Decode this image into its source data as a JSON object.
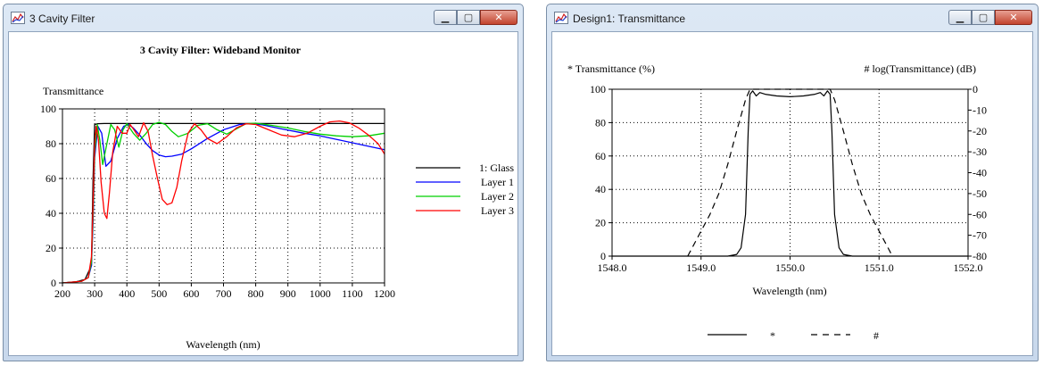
{
  "windows": [
    {
      "title": "3 Cavity Filter",
      "controls": {
        "minimize": "▁",
        "maximize": "▢",
        "close": "✕"
      }
    },
    {
      "title": "Design1: Transmittance",
      "controls": {
        "minimize": "▁",
        "maximize": "▢",
        "close": "✕"
      }
    }
  ],
  "chart_data": [
    {
      "type": "line",
      "title": "3 Cavity Filter: Wideband Monitor",
      "ylabel": "Transmittance",
      "xlabel": "Wavelength (nm)",
      "xlim": [
        200,
        1200
      ],
      "ylim": [
        0,
        100
      ],
      "xticks": [
        200,
        300,
        400,
        500,
        600,
        700,
        800,
        900,
        1000,
        1100,
        1200
      ],
      "yticks": [
        0,
        20,
        40,
        60,
        80,
        100
      ],
      "grid": true,
      "legend_position": "right",
      "series": [
        {
          "name": "1: Glass",
          "color": "#000000",
          "x": [
            200,
            240,
            270,
            290,
            295,
            300,
            310,
            330,
            400,
            600,
            800,
            1000,
            1200
          ],
          "y": [
            0,
            0.5,
            2,
            10,
            60,
            91,
            91.5,
            91.6,
            91.6,
            91.6,
            91.6,
            91.6,
            91.6
          ]
        },
        {
          "name": "Layer 1",
          "color": "#0000ff",
          "x": [
            200,
            260,
            280,
            290,
            295,
            300,
            310,
            322,
            335,
            350,
            370,
            390,
            405,
            420,
            440,
            460,
            480,
            500,
            520,
            540,
            570,
            600,
            650,
            700,
            750,
            780,
            820,
            880,
            950,
            1000,
            1050,
            1100,
            1150,
            1200
          ],
          "y": [
            0,
            1,
            3,
            10,
            35,
            72,
            90,
            86,
            67,
            70,
            83,
            90,
            91,
            89,
            85,
            80,
            76,
            73.5,
            72.5,
            72.8,
            74,
            77,
            83,
            88,
            91,
            91.5,
            90.8,
            88.5,
            86,
            84.5,
            82.5,
            80.5,
            78.5,
            76.5
          ]
        },
        {
          "name": "Layer 2",
          "color": "#00d000",
          "x": [
            200,
            260,
            280,
            290,
            295,
            300,
            308,
            316,
            325,
            338,
            350,
            362,
            375,
            388,
            400,
            420,
            440,
            460,
            480,
            500,
            520,
            540,
            560,
            590,
            620,
            650,
            680,
            710,
            740,
            770,
            800,
            850,
            900,
            950,
            1000,
            1050,
            1100,
            1150,
            1200
          ],
          "y": [
            0,
            1,
            3,
            12,
            40,
            75,
            91,
            82,
            68,
            80,
            91,
            88,
            78,
            88,
            91.5,
            86,
            82,
            86,
            91,
            92.3,
            91,
            87,
            84,
            86,
            90.5,
            91.5,
            88,
            85.5,
            88.5,
            91.5,
            91.8,
            90.5,
            89,
            87,
            85.5,
            84.5,
            84,
            84.5,
            86
          ]
        },
        {
          "name": "Layer 3",
          "color": "#ff0000",
          "x": [
            200,
            260,
            280,
            290,
            295,
            300,
            305,
            312,
            320,
            330,
            338,
            346,
            356,
            370,
            385,
            400,
            410,
            422,
            436,
            452,
            466,
            480,
            495,
            510,
            525,
            540,
            555,
            570,
            590,
            610,
            630,
            650,
            680,
            710,
            740,
            770,
            800,
            840,
            880,
            920,
            960,
            1000,
            1030,
            1060,
            1090,
            1120,
            1150,
            1180,
            1200
          ],
          "y": [
            0,
            1,
            3,
            15,
            45,
            80,
            90,
            82,
            58,
            40,
            37,
            52,
            75,
            90,
            86,
            86,
            91,
            88,
            84,
            92,
            87,
            73,
            60,
            48,
            45,
            46,
            55,
            70,
            86,
            91.5,
            88,
            83,
            80,
            84,
            89,
            91.5,
            91,
            88,
            85,
            84,
            86,
            90,
            92.5,
            93,
            92,
            89,
            85,
            80,
            74
          ]
        }
      ]
    },
    {
      "type": "line",
      "title": "",
      "ylabel_left": "* Transmittance (%)",
      "ylabel_right": "# log(Transmittance) (dB)",
      "xlabel": "Wavelength (nm)",
      "xlim": [
        1548.0,
        1552.0
      ],
      "xticks": [
        "1548.0",
        "1549.0",
        "1550.0",
        "1551.0",
        "1552.0"
      ],
      "ylim_left": [
        0,
        100
      ],
      "yticks_left": [
        0,
        20,
        40,
        60,
        80,
        100
      ],
      "ylim_right": [
        -80,
        0
      ],
      "yticks_right": [
        0,
        -10,
        -20,
        -30,
        -40,
        -50,
        -60,
        -70,
        -80
      ],
      "grid": true,
      "legend_position": "bottom",
      "series": [
        {
          "name": "*",
          "color": "#000000",
          "style": "solid",
          "axis": "left",
          "x": [
            1548.0,
            1549.3,
            1549.4,
            1549.45,
            1549.5,
            1549.53,
            1549.55,
            1549.58,
            1549.62,
            1549.66,
            1549.72,
            1549.85,
            1550.0,
            1550.15,
            1550.28,
            1550.34,
            1550.38,
            1550.42,
            1550.45,
            1550.47,
            1550.5,
            1550.55,
            1550.6,
            1550.7,
            1552.0
          ],
          "y": [
            0,
            0,
            1,
            5,
            25,
            75,
            97,
            99,
            96,
            98,
            97,
            96,
            95.5,
            96,
            97,
            98,
            96,
            99,
            97,
            75,
            25,
            5,
            1,
            0,
            0
          ]
        },
        {
          "name": "#",
          "color": "#000000",
          "style": "dashed",
          "axis": "right",
          "x": [
            1548.85,
            1549.0,
            1549.1,
            1549.2,
            1549.3,
            1549.4,
            1549.5,
            1549.55,
            1550.45,
            1550.5,
            1550.6,
            1550.7,
            1550.8,
            1550.9,
            1551.0,
            1551.15
          ],
          "y": [
            -80,
            -68,
            -60,
            -50,
            -36,
            -20,
            -5,
            0,
            0,
            -5,
            -20,
            -36,
            -50,
            -60,
            -68,
            -80
          ]
        }
      ]
    }
  ]
}
